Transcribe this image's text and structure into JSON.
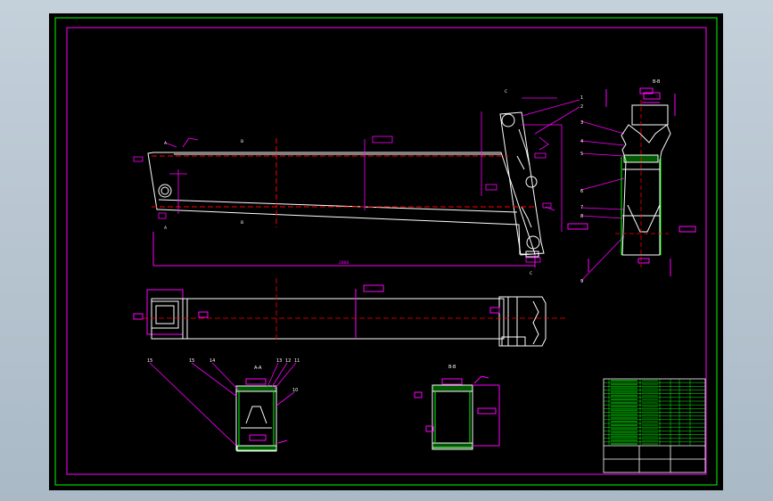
{
  "drawing": {
    "section_labels": {
      "top_right": "B-B",
      "bottom_left": "A-A",
      "bottom_mid": "B-B"
    },
    "dimension_main_length": "2880",
    "cut_markers": {
      "a": "A",
      "b": "B",
      "c": "C"
    },
    "callouts": [
      "1",
      "2",
      "3",
      "4",
      "5",
      "6",
      "7",
      "8",
      "9"
    ],
    "callouts_aa": [
      "15",
      "15",
      "14",
      "13",
      "12",
      "11",
      "10"
    ],
    "title_block": {
      "rows": 18
    }
  },
  "colors": {
    "canvas": "#000000",
    "outer_border": "#00ff00",
    "inner_border": "#ff00ff",
    "part_line": "#ffffff",
    "center_line": "#ff0000",
    "annotation": "#ff00ff",
    "weld_fill": "#00ff00"
  }
}
